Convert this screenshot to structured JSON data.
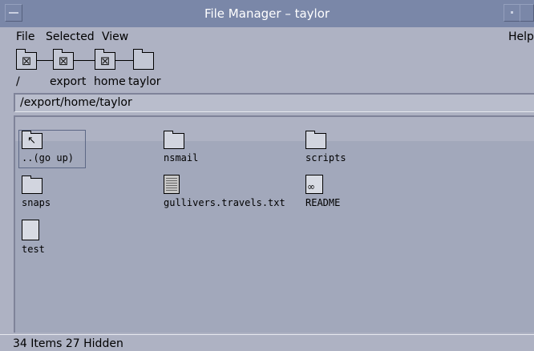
{
  "window": {
    "title": "File Manager – taylor"
  },
  "menubar": {
    "file": "File",
    "selected": "Selected",
    "view": "View",
    "help": "Help"
  },
  "path_icons": {
    "icons": [
      "folder-x-icon",
      "folder-x-icon",
      "folder-x-icon",
      "folder-icon"
    ]
  },
  "path_labels": {
    "root": "/",
    "export": "export",
    "home": "home",
    "taylor": "taylor"
  },
  "path_field": {
    "value": "/export/home/taylor"
  },
  "files": [
    {
      "name": "..(go up)",
      "icon": "go-up-folder-icon"
    },
    {
      "name": "nsmail",
      "icon": "folder-icon"
    },
    {
      "name": "scripts",
      "icon": "folder-icon"
    },
    {
      "name": "snaps",
      "icon": "folder-icon"
    },
    {
      "name": "gullivers.travels.txt",
      "icon": "text-document-icon"
    },
    {
      "name": "README",
      "icon": "readme-document-icon"
    },
    {
      "name": "test",
      "icon": "blank-document-icon"
    }
  ],
  "status": {
    "text": "34 Items 27 Hidden"
  },
  "colors": {
    "title_bar": "#7a87a8",
    "window_bg": "#aeb2c3"
  }
}
